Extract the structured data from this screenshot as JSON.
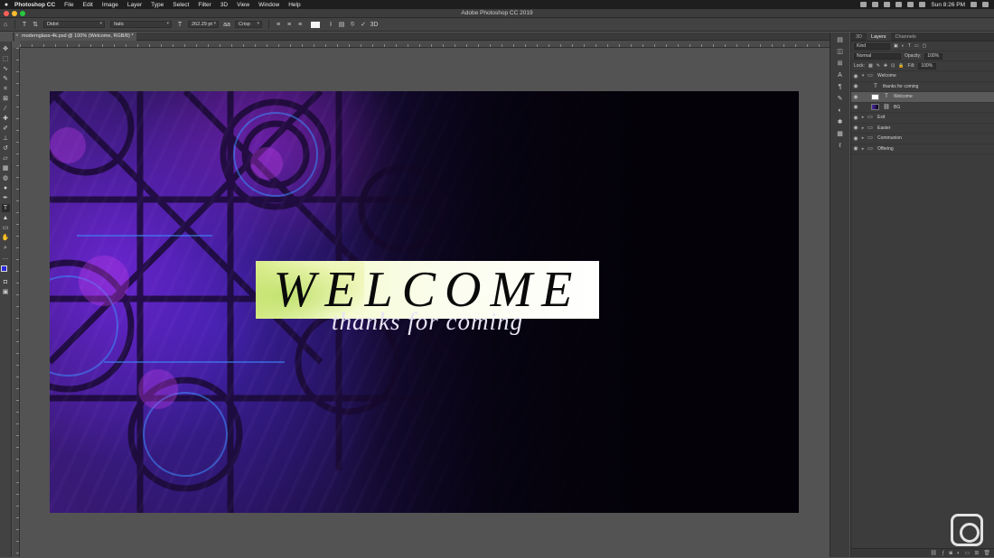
{
  "menubar": {
    "apple": "",
    "items": [
      "Photoshop CC",
      "File",
      "Edit",
      "Image",
      "Layer",
      "Type",
      "Select",
      "Filter",
      "3D",
      "View",
      "Window",
      "Help"
    ],
    "clock": "Sun 8:26 PM"
  },
  "window": {
    "title": "Adobe Photoshop CC 2019"
  },
  "options_bar": {
    "font_family": "Didot",
    "font_style": "Italic",
    "font_size": "262.29 pt",
    "antialias": "Crisp",
    "aa_label": "aa",
    "size_glyph": "T",
    "commit_glyph": "✓",
    "cancel_glyph": "⦸",
    "three_d": "3D"
  },
  "document": {
    "tab_title": "modernglass-4k.psd @ 100% (Welcome, RGB/8) *",
    "close_glyph": "×"
  },
  "canvas": {
    "headline": "WELCOME",
    "subline": "thanks for coming"
  },
  "layers_panel": {
    "tabs": [
      "3D",
      "Layers",
      "Channels"
    ],
    "active_tab": "Layers",
    "filter_label": "Kind",
    "blend_mode": "Normal",
    "opacity_label": "Opacity:",
    "opacity_value": "100%",
    "lock_label": "Lock:",
    "fill_label": "Fill:",
    "fill_value": "100%",
    "layers": [
      {
        "name": "Welcome",
        "kind": "group",
        "expanded": true,
        "indent": 0
      },
      {
        "name": "thanks for coming",
        "kind": "text",
        "indent": 1
      },
      {
        "name": "Welcome",
        "kind": "text",
        "indent": 1,
        "selected": true
      },
      {
        "name": "BG",
        "kind": "image",
        "indent": 1
      },
      {
        "name": "Exit",
        "kind": "group",
        "expanded": false,
        "indent": 0
      },
      {
        "name": "Easter",
        "kind": "group",
        "expanded": false,
        "indent": 0
      },
      {
        "name": "Communion",
        "kind": "group",
        "expanded": false,
        "indent": 0
      },
      {
        "name": "Offering",
        "kind": "group",
        "expanded": false,
        "indent": 0
      }
    ]
  },
  "colors": {
    "foreground": "#2e2bdc",
    "background": "#111111",
    "accent": "#5a5a5a"
  }
}
